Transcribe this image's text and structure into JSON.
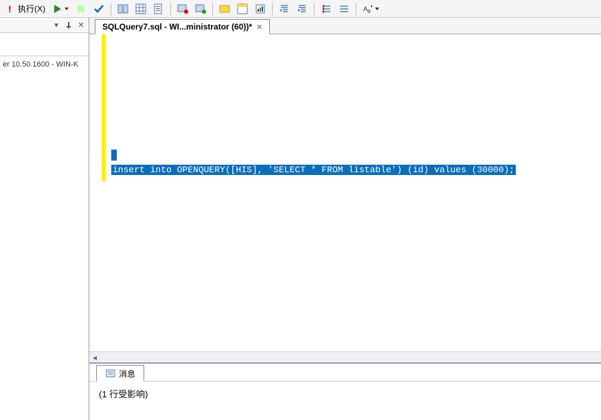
{
  "toolbar": {
    "execute_label": "执行(X)"
  },
  "left_panel": {
    "server_text": "er 10.50.1600 - WIN-K"
  },
  "tab": {
    "title": "SQLQuery7.sql - WI...ministrator (60))*"
  },
  "editor": {
    "sql": "insert into OPENQUERY([HIS], 'SELECT * FROM  listable') (id) values (30000);"
  },
  "messages": {
    "tab_label": "消息",
    "body": "(1 行受影响)"
  }
}
